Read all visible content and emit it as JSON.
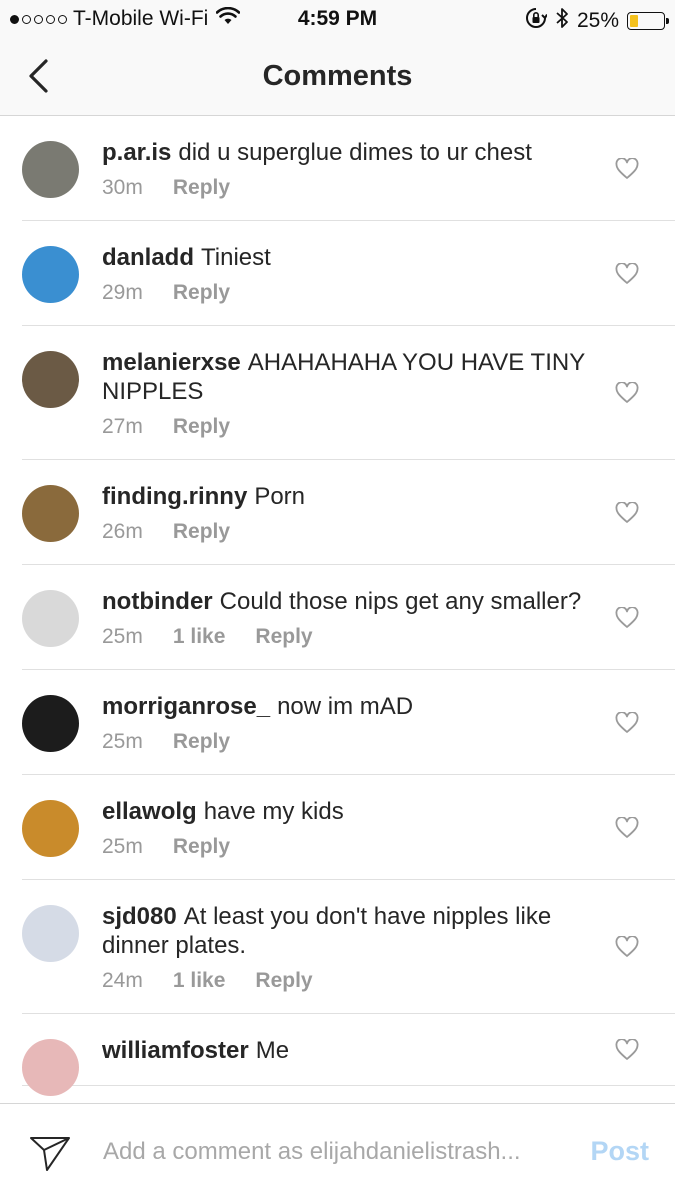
{
  "status_bar": {
    "carrier": "T-Mobile Wi-Fi",
    "time": "4:59 PM",
    "battery": "25%",
    "battery_level": 0.25,
    "icons": [
      "signal-dots-icon",
      "wifi-icon",
      "rotation-lock-icon",
      "bluetooth-icon",
      "battery-icon"
    ]
  },
  "nav": {
    "title": "Comments",
    "back_icon": "chevron-left-icon"
  },
  "comments": [
    {
      "username": "p.ar.is",
      "text": "did u superglue dimes to ur chest",
      "time": "30m",
      "likes": "",
      "reply": "Reply",
      "avatar_color": "#7a7a72"
    },
    {
      "username": "danladd",
      "text": "Tiniest",
      "time": "29m",
      "likes": "",
      "reply": "Reply",
      "avatar_color": "#3a8fd1"
    },
    {
      "username": "melanierxse",
      "text": "AHAHAHAHA YOU HAVE TINY NIPPLES",
      "time": "27m",
      "likes": "",
      "reply": "Reply",
      "avatar_color": "#6b5a45"
    },
    {
      "username": "finding.rinny",
      "text": "Porn",
      "time": "26m",
      "likes": "",
      "reply": "Reply",
      "avatar_color": "#8a6a3c"
    },
    {
      "username": "notbinder",
      "text": "Could those nips get any smaller?",
      "time": "25m",
      "likes": "1 like",
      "reply": "Reply",
      "avatar_color": "#d9d9d9"
    },
    {
      "username": "morriganrose_",
      "text": "now im mAD",
      "time": "25m",
      "likes": "",
      "reply": "Reply",
      "avatar_color": "#1c1c1c"
    },
    {
      "username": "ellawolg",
      "text": "have my kids",
      "time": "25m",
      "likes": "",
      "reply": "Reply",
      "avatar_color": "#c98b2b"
    },
    {
      "username": "sjd080",
      "text": "At least you don't have nipples like dinner plates.",
      "time": "24m",
      "likes": "1 like",
      "reply": "Reply",
      "avatar_color": "#d5dbe6"
    },
    {
      "username": "williamfoster",
      "text": "Me",
      "time": "",
      "likes": "",
      "reply": "",
      "avatar_color": "#e7b8b8"
    }
  ],
  "input_bar": {
    "placeholder": "Add a comment as elijahdanielistrash...",
    "post_label": "Post",
    "send_icon": "send-icon"
  },
  "colors": {
    "accent": "#b3d6f5",
    "meta_gray": "#999999",
    "text": "#262626"
  }
}
